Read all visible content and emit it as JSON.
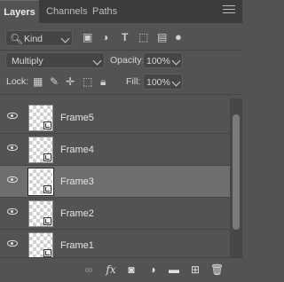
{
  "tabs": [
    {
      "label": "Layers",
      "active": true
    },
    {
      "label": "Channels",
      "active": false
    },
    {
      "label": "Paths",
      "active": false
    }
  ],
  "filter": {
    "kind_label": "Kind",
    "icons": [
      "search-icon",
      "image-filter-icon",
      "adjustment-filter-icon",
      "type-filter-icon",
      "shape-filter-icon",
      "smart-object-filter-icon",
      "filter-toggle-icon"
    ]
  },
  "blend": {
    "mode": "Multiply",
    "opacity_label": "Opacity:",
    "opacity_value": "100%"
  },
  "lock": {
    "label": "Lock:",
    "fill_label": "Fill:",
    "fill_value": "100%"
  },
  "layers": [
    {
      "name": "Frame5",
      "selected": false
    },
    {
      "name": "Frame4",
      "selected": false
    },
    {
      "name": "Frame3",
      "selected": true
    },
    {
      "name": "Frame2",
      "selected": false
    },
    {
      "name": "Frame1",
      "selected": false
    }
  ],
  "footer": {
    "fx_label": "fx"
  }
}
